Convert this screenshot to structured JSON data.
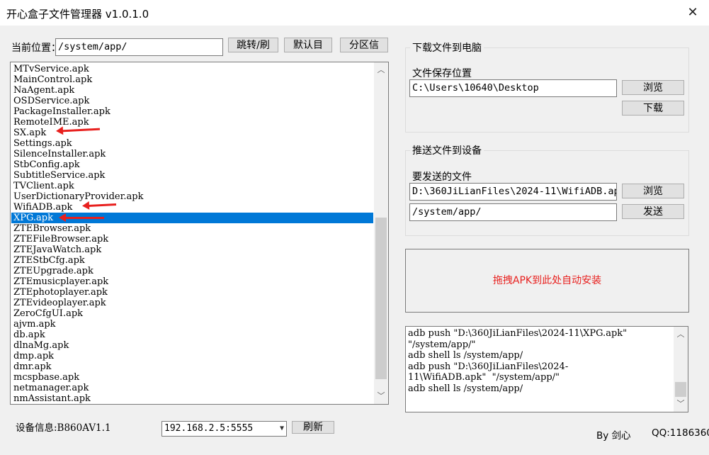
{
  "window": {
    "title": "开心盒子文件管理器  v1.0.1.0",
    "close_glyph": "✕"
  },
  "location": {
    "label": "当前位置：",
    "value": "/system/app/",
    "jump_button": "跳转/刷",
    "default_button": "默认目",
    "partition_button": "分区信"
  },
  "file_list": {
    "items": [
      "MTvService.apk",
      "MainControl.apk",
      "NaAgent.apk",
      "OSDService.apk",
      "PackageInstaller.apk",
      "RemoteIME.apk",
      "SX.apk",
      "Settings.apk",
      "SilenceInstaller.apk",
      "StbConfig.apk",
      "SubtitleService.apk",
      "TVClient.apk",
      "UserDictionaryProvider.apk",
      "WifiADB.apk",
      "XPG.apk",
      "ZTEBrowser.apk",
      "ZTEFileBrowser.apk",
      "ZTEJavaWatch.apk",
      "ZTEStbCfg.apk",
      "ZTEUpgrade.apk",
      "ZTEmusicplayer.apk",
      "ZTEphotoplayer.apk",
      "ZTEvideoplayer.apk",
      "ZeroCfgUI.apk",
      "ajvm.apk",
      "db.apk",
      "dlnaMg.apk",
      "dmp.apk",
      "dmr.apk",
      "mcspbase.apk",
      "netmanager.apk",
      "nmAssistant.apk"
    ],
    "selected_item": "XPG.apk",
    "highlight_color": "#0078d7",
    "annotation_color": "#e8201e"
  },
  "download": {
    "group_title": "下载文件到电脑",
    "save_label": "文件保存位置",
    "save_path": "C:\\Users\\10640\\Desktop",
    "browse_button": "浏览",
    "download_button": "下载"
  },
  "push": {
    "group_title": "推送文件到设备",
    "file_label": "要发送的文件",
    "file_path": "D:\\360JiLianFiles\\2024-11\\WifiADB.ap",
    "target_path": "/system/app/",
    "browse_button": "浏览",
    "send_button": "发送"
  },
  "dropzone": {
    "text": "拖拽APK到此处自动安装"
  },
  "log": {
    "lines": [
      "adb push \"D:\\360JiLianFiles\\2024-11\\XPG.apk\"",
      "\"/system/app/\"",
      "adb shell ls /system/app/",
      "adb push \"D:\\360JiLianFiles\\2024-",
      "11\\WifiADB.apk\"  \"/system/app/\"",
      "adb shell ls /system/app/"
    ]
  },
  "footer": {
    "device_info": "设备信息:B860AV1.1",
    "device_address": "192.168.2.5:5555",
    "refresh_button": "刷新",
    "author": "By 剑心",
    "qq": "QQ:1186360"
  }
}
